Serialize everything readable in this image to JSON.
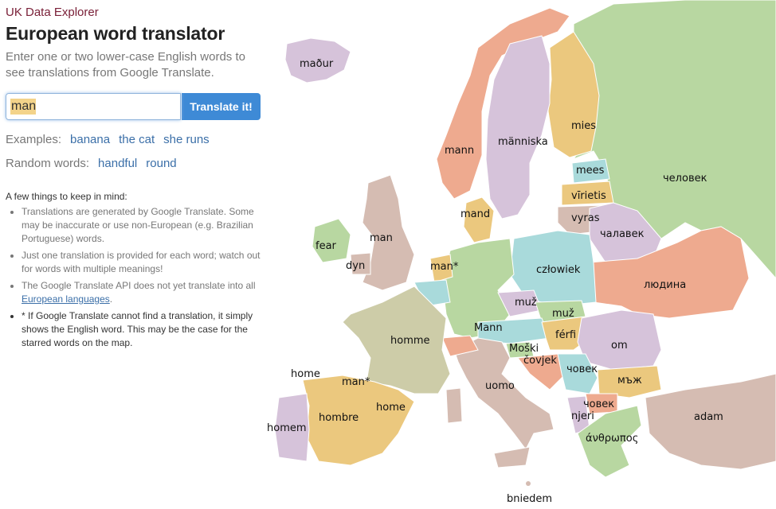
{
  "header": {
    "brand": "UK Data Explorer",
    "title": "European word translator",
    "subtitle": "Enter one or two lower-case English words to see translations from Google Translate."
  },
  "search": {
    "value": "man",
    "button_label": "Translate it!"
  },
  "examples": {
    "label": "Examples:",
    "items": [
      "banana",
      "the cat",
      "she runs"
    ]
  },
  "random": {
    "label": "Random words:",
    "items": [
      "handful",
      "round"
    ]
  },
  "notes": {
    "heading": "A few things to keep in mind:",
    "items": [
      "Translations are generated by Google Translate. Some may be inaccurate or use non-European (e.g. Brazilian Portuguese) words.",
      "Just one translation is provided for each word; watch out for words with multiple meanings!",
      "The Google Translate API does not yet translate into all",
      "* If Google Translate cannot find a translation, it simply shows the English word. This may be the case for the starred words on the map."
    ],
    "link_text": "European languages",
    "link_suffix": "."
  },
  "map": {
    "labels": {
      "iceland": "maður",
      "norway": "mann",
      "sweden": "människa",
      "finland": "mies",
      "estonia": "mees",
      "latvia": "vīrietis",
      "lithuania": "vyras",
      "russia": "человек",
      "belarus": "чалавек",
      "ukraine": "людина",
      "poland": "człowiek",
      "denmark": "mand",
      "uk": "man",
      "ireland": "fear",
      "wales": "dyn",
      "netherlands": "man*",
      "germany": "Mann",
      "czechia": "muž",
      "slovakia": "muž",
      "hungary": "férfi",
      "romania": "om",
      "slovenia": "Moški",
      "croatia": "čovjek",
      "serbia": "човек",
      "bulgaria": "мъж",
      "macedonia": "човек",
      "albania": "njeri",
      "greece": "άνθρωπος",
      "turkey": "adam",
      "italy": "uomo",
      "malta": "bniedem",
      "france": "homme",
      "spain": "hombre",
      "portugal": "homem",
      "basque": "man*",
      "galicia": "home",
      "catalonia": "home"
    },
    "colors": {
      "sea": "#ffffff",
      "green": "#b8d7a1",
      "salmon": "#eeaa8f",
      "lilac": "#d6c3da",
      "mustard": "#ebc87e",
      "teal": "#a9dadb",
      "taupe": "#d5bcb2",
      "sage": "#cdcca8"
    }
  }
}
